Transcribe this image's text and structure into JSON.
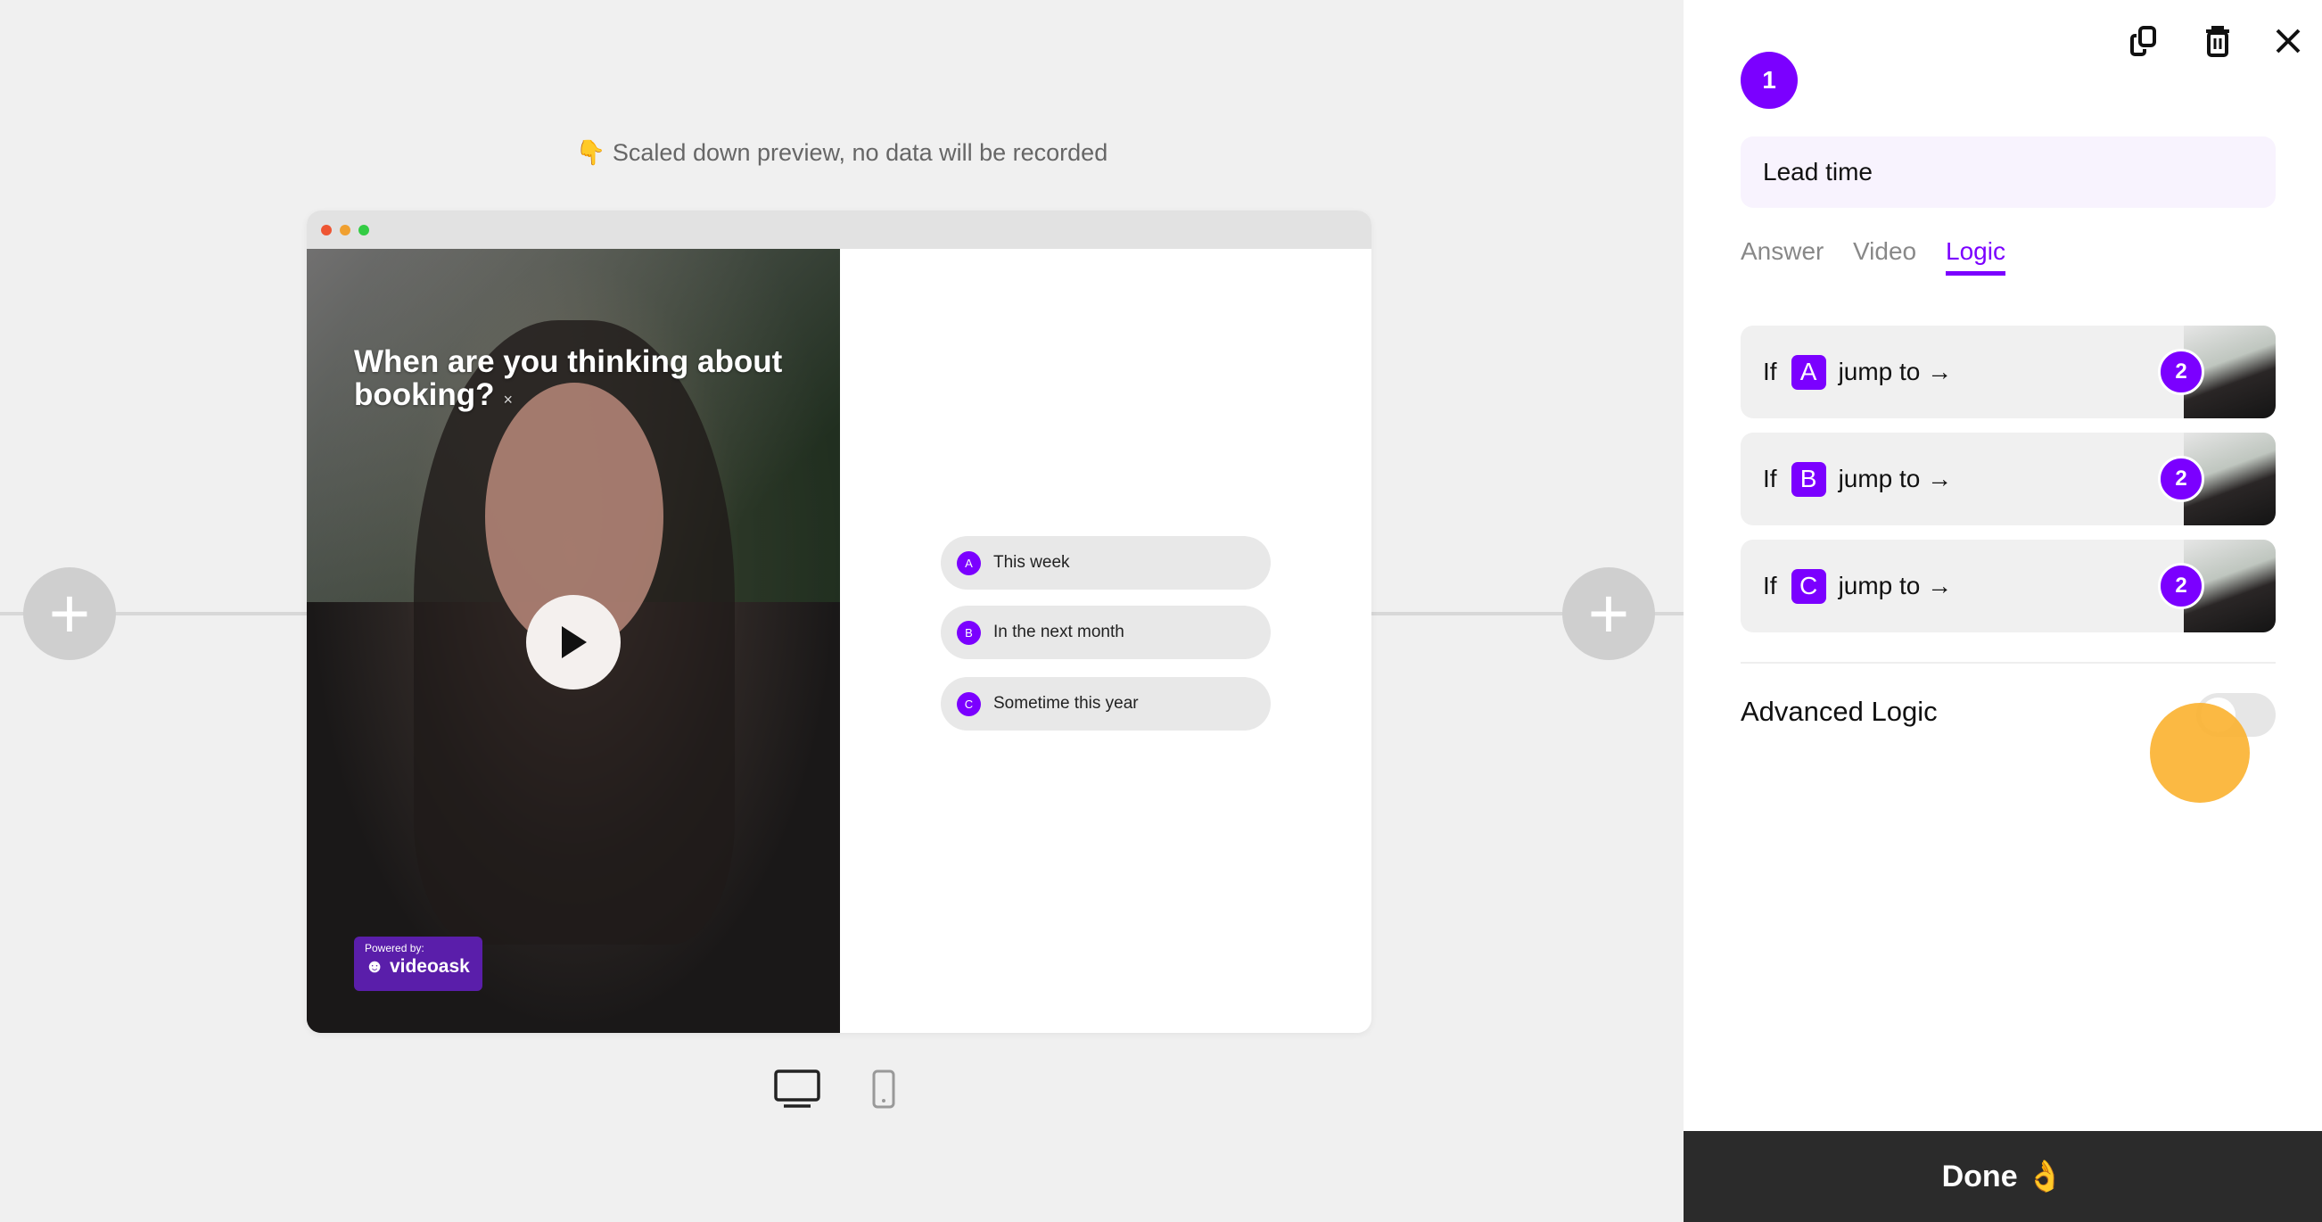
{
  "preview": {
    "notice_icon": "pointing-down-hand",
    "notice": "👇 Scaled down preview, no data will be recorded",
    "question": "When are you thinking about booking?",
    "question_close": "×",
    "powered_by": "Powered by:",
    "brand": "videoask",
    "options": [
      {
        "letter": "A",
        "label": "This week"
      },
      {
        "letter": "B",
        "label": "In the next month"
      },
      {
        "letter": "C",
        "label": "Sometime this year"
      }
    ],
    "window_dots": [
      "#ee5533",
      "#f0a030",
      "#33cc44"
    ]
  },
  "panel": {
    "step_number": "1",
    "title_value": "Lead time",
    "tabs": [
      {
        "label": "Answer"
      },
      {
        "label": "Video"
      },
      {
        "label": "Logic",
        "active": true
      }
    ],
    "logic_rows": [
      {
        "if": "If",
        "letter": "A",
        "jump": "jump to →",
        "target": "2"
      },
      {
        "if": "If",
        "letter": "B",
        "jump": "jump to →",
        "target": "2"
      },
      {
        "if": "If",
        "letter": "C",
        "jump": "jump to →",
        "target": "2"
      }
    ],
    "advanced_logic_label": "Advanced Logic",
    "advanced_logic_on": false,
    "done_label": "Done 👌"
  },
  "colors": {
    "accent": "#7b00ff",
    "done_bg": "#2b2b2b",
    "canvas_bg": "#f0f0f0"
  }
}
